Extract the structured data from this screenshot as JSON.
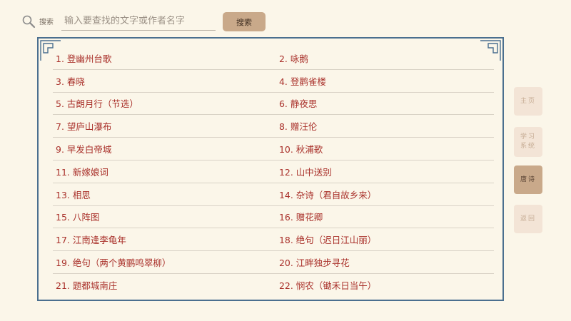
{
  "search": {
    "label": "搜索",
    "placeholder": "输入要查找的文字或作者名字",
    "value": "",
    "button_label": "搜索"
  },
  "poems": [
    "1. 登幽州台歌",
    "2. 咏鹅",
    "3. 春晓",
    "4. 登鹳雀楼",
    "5. 古朗月行（节选）",
    "6. 静夜思",
    "7. 望庐山瀑布",
    "8. 赠汪伦",
    "9. 早发白帝城",
    "10. 秋浦歌",
    "11. 新嫁娘词",
    "12. 山中送别",
    "13. 相思",
    "14. 杂诗（君自故乡来）",
    "15. 八阵图",
    "16. 赠花卿",
    "17. 江南逢李龟年",
    "18. 绝句（迟日江山丽）",
    "19. 绝句（两个黄鹂鸣翠柳）",
    "20. 江畔独步寻花",
    "21. 题都城南庄",
    "22. 悯农（锄禾日当午）"
  ],
  "nav": {
    "home": "主页",
    "study_line1": "学习",
    "study_line2": "系统",
    "poems": "唐诗",
    "back": "返回"
  },
  "colors": {
    "background": "#fbf6e9",
    "accent": "#c9a98a",
    "frame": "#4a6f8f",
    "poem_text": "#a9302a"
  },
  "icons": {
    "search": "search-icon",
    "frame_corner": "corner-ornament-icon"
  }
}
